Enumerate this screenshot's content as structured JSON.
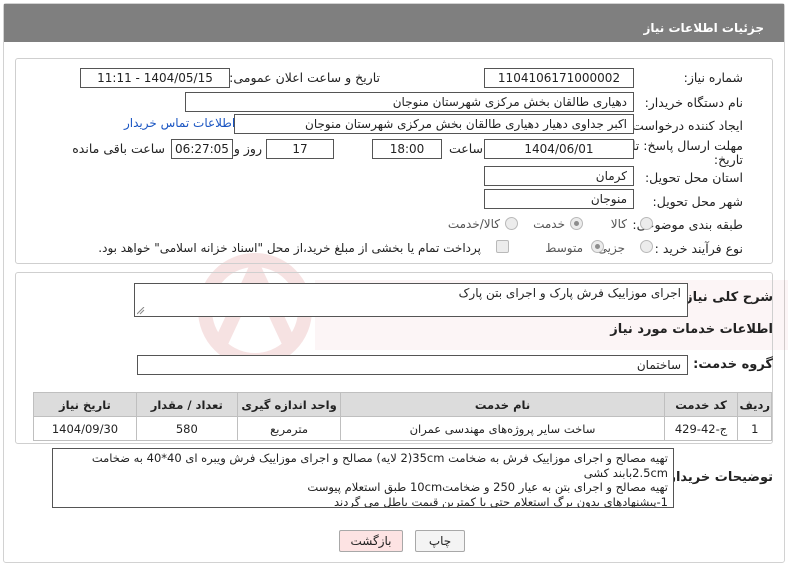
{
  "page": {
    "title": "جزئیات اطلاعات نیاز"
  },
  "fields": {
    "need_number_label": "شماره نیاز:",
    "need_number": "1104106171000002",
    "announce_label": "تاریخ و ساعت اعلان عمومی:",
    "announce_value": "1404/05/15 - 11:11",
    "buyer_label": "نام دستگاه خریدار:",
    "buyer_value": "دهیاری طالقان بخش مرکزی شهرستان منوجان",
    "creator_label": "ایجاد کننده درخواست:",
    "creator_value": "اکبر جداوی دهیار دهیاری طالقان بخش مرکزی شهرستان منوجان",
    "contact_link": "اطلاعات تماس خریدار",
    "deadline_label_1": "مهلت ارسال پاسخ: تا",
    "deadline_label_2": "تاریخ:",
    "deadline_date": "1404/06/01",
    "time_label": "ساعت",
    "deadline_time": "18:00",
    "days_value": "17",
    "days_label": "روز و",
    "remaining_time": "06:27:05",
    "remaining_label": "ساعت باقی مانده",
    "province_label": "استان محل تحویل:",
    "province_value": "کرمان",
    "city_label": "شهر محل تحویل:",
    "city_value": "منوجان",
    "category_label": "طبقه بندی موضوعی:",
    "category_options": [
      "کالا",
      "خدمت",
      "کالا/خدمت"
    ],
    "category_selected": "خدمت",
    "process_label": "نوع فرآیند خرید :",
    "process_options": [
      "جزیی",
      "متوسط"
    ],
    "process_selected": "متوسط",
    "payment_note": "پرداخت تمام یا بخشی از مبلغ خرید،از محل \"اسناد خزانه اسلامی\" خواهد بود."
  },
  "description": {
    "label": "شرح کلی نیاز:",
    "value": "اجرای موزاییک فرش پارک و اجرای بتن پارک"
  },
  "services": {
    "header": "اطلاعات خدمات مورد نیاز",
    "group_label": "گروه خدمت:",
    "group_value": "ساختمان",
    "columns": [
      "ردیف",
      "کد خدمت",
      "نام خدمت",
      "واحد اندازه گیری",
      "تعداد / مقدار",
      "تاریخ نیاز"
    ],
    "rows": [
      {
        "row": "1",
        "code": "ج-42-429",
        "name": "ساخت سایر پروژه‌های مهندسی عمران",
        "unit": "مترمربع",
        "qty": "580",
        "date": "1404/09/30"
      }
    ]
  },
  "buyer_notes": {
    "label": "توضیحات خریدار:",
    "lines": [
      "تهیه مصالح و اجرای موزاییک فرش به ضخامت 35cm(2 لایه) مصالح و اجرای موزاییک فرش ویبره ای 40*40 به ضخامت",
      "2.5cmبابند کشی",
      "تهیه مصالح و اجرای بتن به عیار 250 و ضخامت10cm طبق استعلام پیوست",
      "1-پیشنهادهای بدون برگ استعلام حتی با کمترین قیمت باطل می گردند"
    ]
  },
  "buttons": {
    "print": "چاپ",
    "back": "بازگشت"
  },
  "colors": {
    "title_bar": "#7f7f7f",
    "link": "#1a55c2",
    "back_button": "#fde3e3"
  }
}
